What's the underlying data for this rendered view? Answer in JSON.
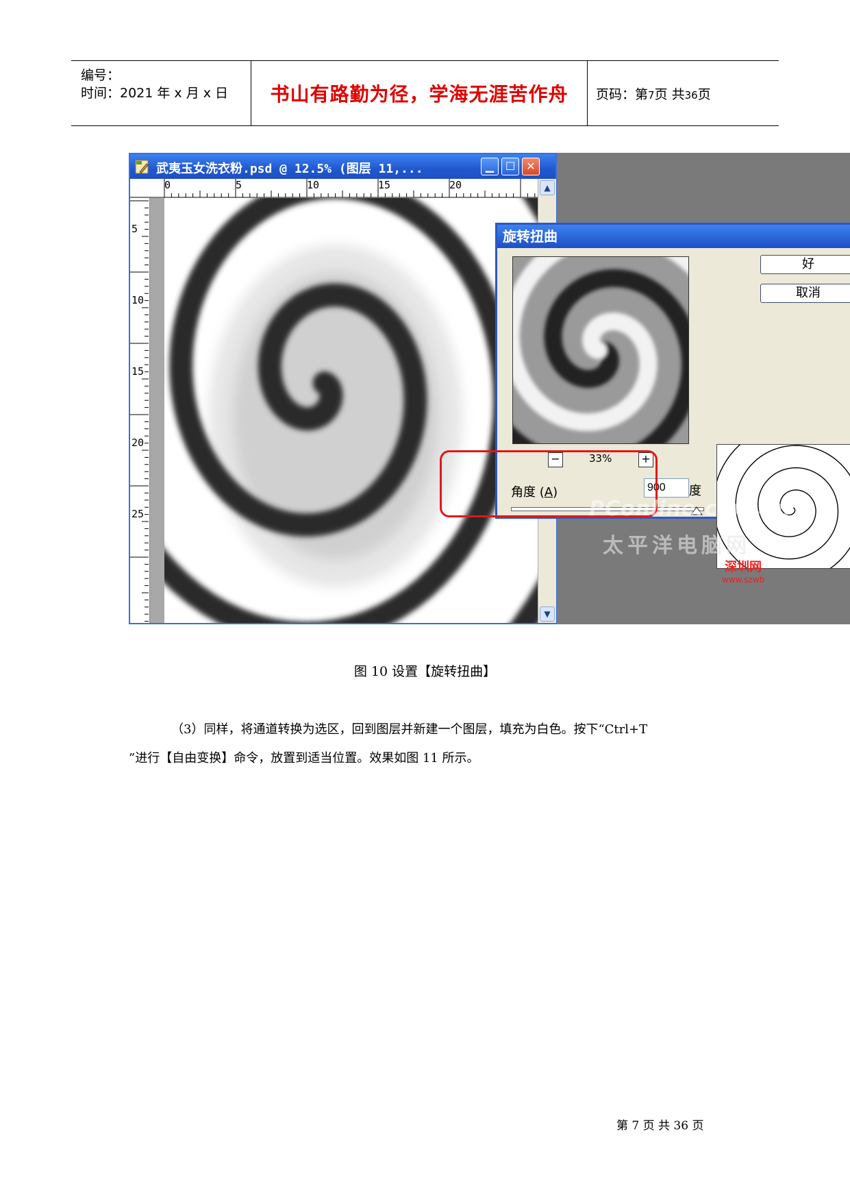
{
  "header": {
    "number_label": "编号：",
    "time_label": "时间：2021 年 x 月 x 日",
    "motto": "书山有路勤为径，学海无涯苦作舟",
    "page_label": "页码：第",
    "page_num": "7",
    "page_mid": "页  共",
    "page_total": "36",
    "page_end": "页"
  },
  "figure": {
    "doc_window": {
      "title": "武夷玉女洗衣粉.psd @ 12.5% (图层 11,...",
      "ruler_h_ticks": [
        "0",
        "5",
        "10",
        "15",
        "20"
      ],
      "ruler_v_ticks": [
        "5",
        "10",
        "15",
        "20",
        "25"
      ]
    },
    "dialog": {
      "title": "旋转扭曲",
      "ok": "好",
      "cancel": "取消",
      "zoom_minus": "−",
      "zoom_plus": "+",
      "zoom_value": "33%",
      "angle_label": "角度",
      "angle_key": "A",
      "angle_value": "900",
      "angle_unit": "度",
      "slider_fraction": 1.0
    },
    "watermark": {
      "line1": "PConline.com.cn",
      "line2": "太平洋电脑网",
      "line3": "深圳网",
      "line4": "www.szwb"
    },
    "caption": "图 10  设置【旋转扭曲】"
  },
  "body": {
    "line1": "（3）同样，将通道转换为选区，回到图层并新建一个图层，填充为白色。按下“Ctrl+T",
    "line2": "”进行【自由变换】命令，放置到适当位置。效果如图 11 所示。"
  },
  "footer": "第  7  页  共  36  页",
  "colors": {
    "motto": "#e00000",
    "titlebar": "#2158d0",
    "highlight": "#e01818"
  }
}
